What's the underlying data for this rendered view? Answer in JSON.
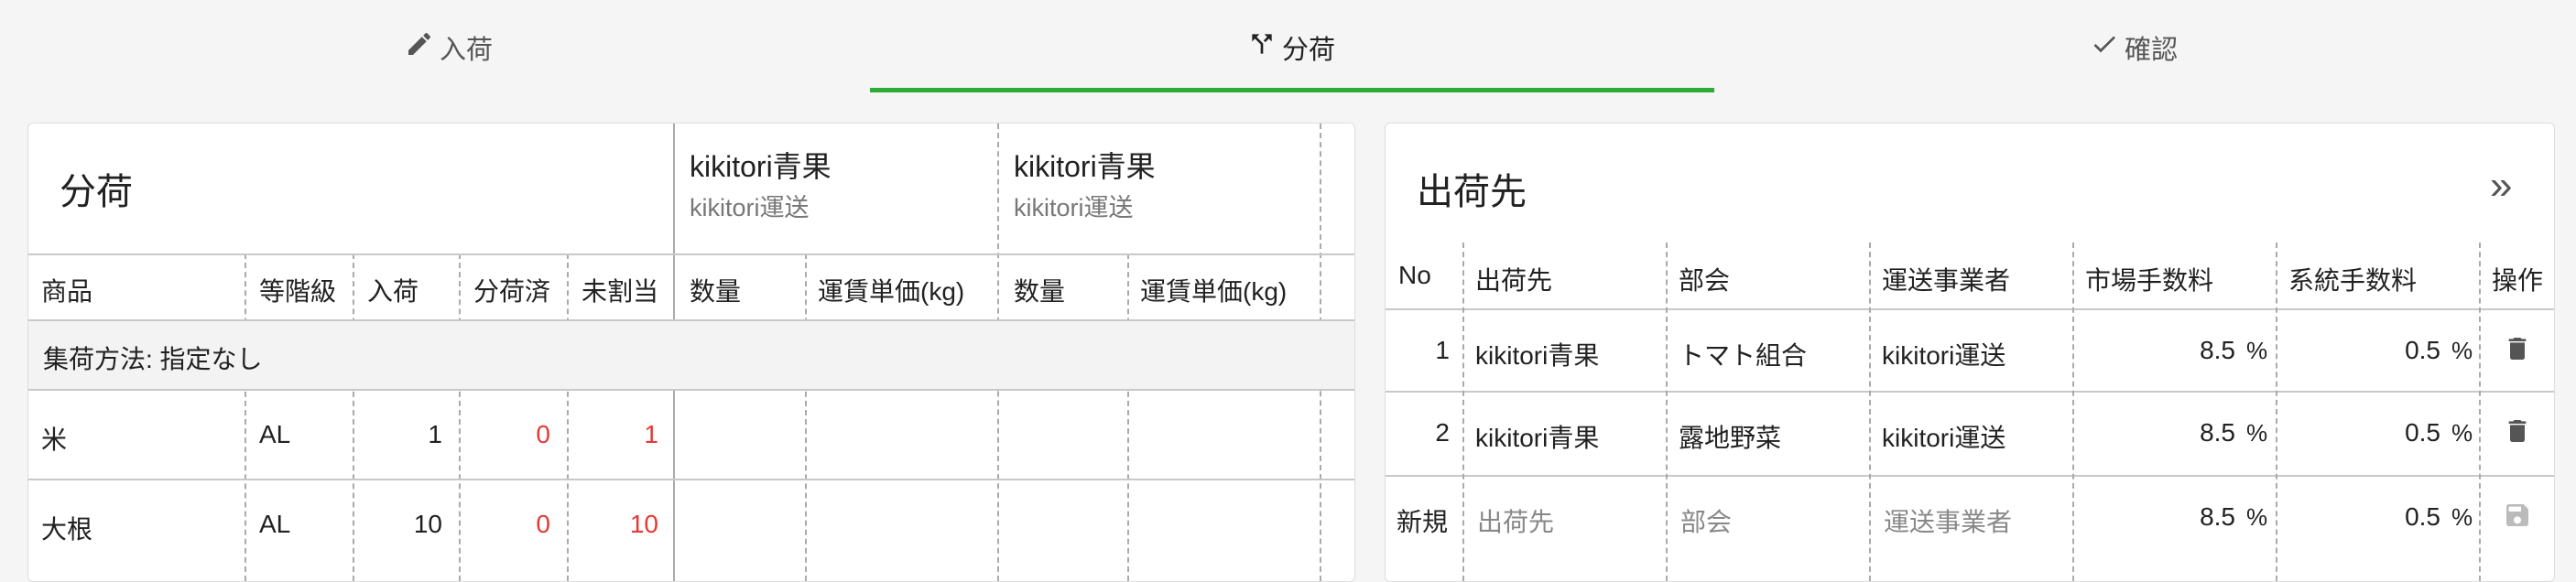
{
  "tabs": [
    {
      "label": "入荷",
      "icon": "pencil-icon"
    },
    {
      "label": "分荷",
      "icon": "split-icon"
    },
    {
      "label": "確認",
      "icon": "check-icon"
    }
  ],
  "left": {
    "title": "分荷",
    "shippers": [
      {
        "name": "kikitori青果",
        "carrier": "kikitori運送"
      },
      {
        "name": "kikitori青果",
        "carrier": "kikitori運送"
      }
    ],
    "headers": [
      "商品",
      "等階級",
      "入荷",
      "分荷済",
      "未割当",
      "数量",
      "運賃単価(kg)",
      "数量",
      "運賃単価(kg)"
    ],
    "group_label": "集荷方法: 指定なし",
    "rows": [
      {
        "product": "米",
        "grade": "AL",
        "received": "1",
        "allocated": "0",
        "unassigned": "1"
      },
      {
        "product": "大根",
        "grade": "AL",
        "received": "10",
        "allocated": "0",
        "unassigned": "10"
      }
    ]
  },
  "right": {
    "title": "出荷先",
    "headers": [
      "No",
      "出荷先",
      "部会",
      "運送事業者",
      "市場手数料",
      "系統手数料",
      "操作"
    ],
    "rows": [
      {
        "no": "1",
        "dest": "kikitori青果",
        "group": "トマト組合",
        "carrier": "kikitori運送",
        "market_fee": "8.5",
        "system_fee": "0.5",
        "unit": "%"
      },
      {
        "no": "2",
        "dest": "kikitori青果",
        "group": "露地野菜",
        "carrier": "kikitori運送",
        "market_fee": "8.5",
        "system_fee": "0.5",
        "unit": "%"
      }
    ],
    "new_row": {
      "label": "新規",
      "dest_placeholder": "出荷先",
      "group_placeholder": "部会",
      "carrier_placeholder": "運送事業者",
      "market_fee": "8.5",
      "system_fee": "0.5",
      "unit": "%"
    }
  }
}
